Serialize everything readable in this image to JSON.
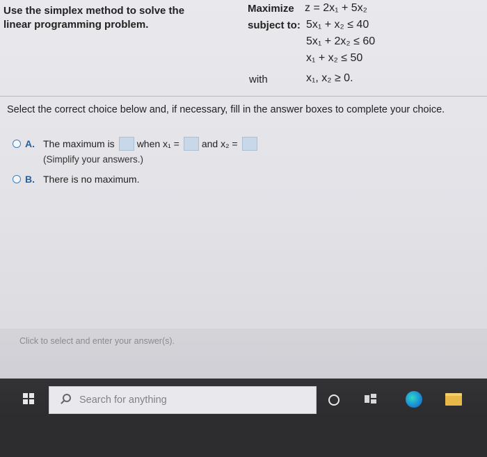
{
  "problem": {
    "instruction": "Use the simplex method to solve the linear programming problem.",
    "maximize_label": "Maximize",
    "objective": "z = 2x₁ + 5x₂",
    "subject_to_label": "subject to:",
    "constraints": [
      "5x₁ + x₂ ≤ 40",
      "5x₁ + 2x₂ ≤ 60",
      "x₁ + x₂ ≤ 50"
    ],
    "with_label": "with",
    "nonnegativity": "x₁, x₂ ≥ 0."
  },
  "question": {
    "prompt": "Select the correct choice below and, if necessary, fill in the answer boxes to complete your choice.",
    "option_a": {
      "letter": "A.",
      "part1": "The maximum is",
      "part2": "when x₁ =",
      "part3": "and x₂ =",
      "hint": "(Simplify your answers.)"
    },
    "option_b": {
      "letter": "B.",
      "text": "There is no maximum."
    }
  },
  "status": {
    "text": "Click to select and enter your answer(s)."
  },
  "taskbar": {
    "search_placeholder": "Search for anything"
  },
  "colors": {
    "accent": "#3a7fbf",
    "answer_box": "#c8d8e8",
    "taskbar": "#2f2f32"
  }
}
